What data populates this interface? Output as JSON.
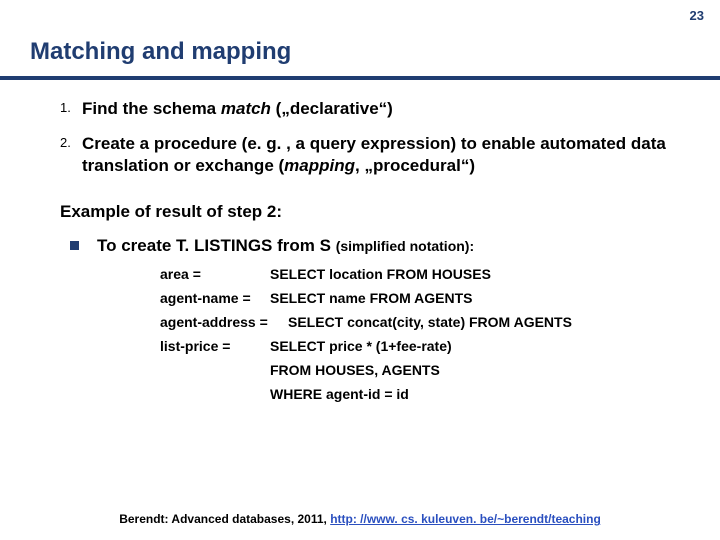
{
  "page_number": "23",
  "title": "Matching and mapping",
  "items": [
    {
      "num": "1.",
      "text_before": "Find the schema ",
      "em": "match",
      "text_after": " („declarative“)"
    },
    {
      "num": "2.",
      "text_before": "Create a procedure (e. g. , a query expression) to enable automated data translation or exchange (",
      "em": "mapping",
      "text_after": ", „procedural“)"
    }
  ],
  "example_heading": "Example of result of step 2:",
  "bullet_main": "To create T. LISTINGS from S ",
  "bullet_note": "(simplified notation):",
  "rows": [
    {
      "label": "area =",
      "val": "SELECT location FROM HOUSES"
    },
    {
      "label": "agent-name =",
      "val": "SELECT name FROM AGENTS"
    },
    {
      "label": "agent-address =",
      "val": "SELECT concat(city, state) FROM AGENTS"
    },
    {
      "label": "list-price =",
      "val": "SELECT price * (1+fee-rate)"
    },
    {
      "label": "",
      "val": "FROM HOUSES, AGENTS"
    },
    {
      "label": "",
      "val": "WHERE agent-id = id"
    }
  ],
  "footer_prefix": "Berendt: Advanced databases, 2011, ",
  "footer_link": "http: //www. cs. kuleuven. be/~berendt/teaching"
}
